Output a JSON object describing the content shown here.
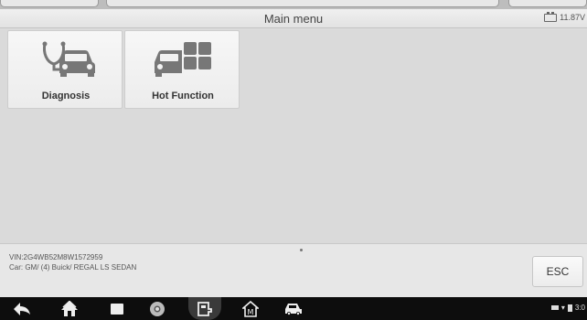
{
  "header": {
    "title": "Main menu",
    "battery_voltage": "11.87V"
  },
  "menu": {
    "tiles": [
      {
        "label": "Diagnosis",
        "icon": "car-stethoscope-icon"
      },
      {
        "label": "Hot Function",
        "icon": "car-grid-icon"
      }
    ]
  },
  "footer": {
    "vin": "VIN:2G4WB52M8W1572959",
    "car": "Car: GM/ (4) Buick/ REGAL LS SEDAN",
    "esc_label": "ESC"
  },
  "navbar": {
    "buttons": [
      "back-icon",
      "home-icon",
      "recent-apps-icon",
      "browser-icon",
      "connect-icon",
      "app-home-icon",
      "car-icon"
    ],
    "status_time": "3:0"
  },
  "colors": {
    "background": "#dadada",
    "navbar": "#0d0d0d",
    "icon_gray": "#777777"
  }
}
